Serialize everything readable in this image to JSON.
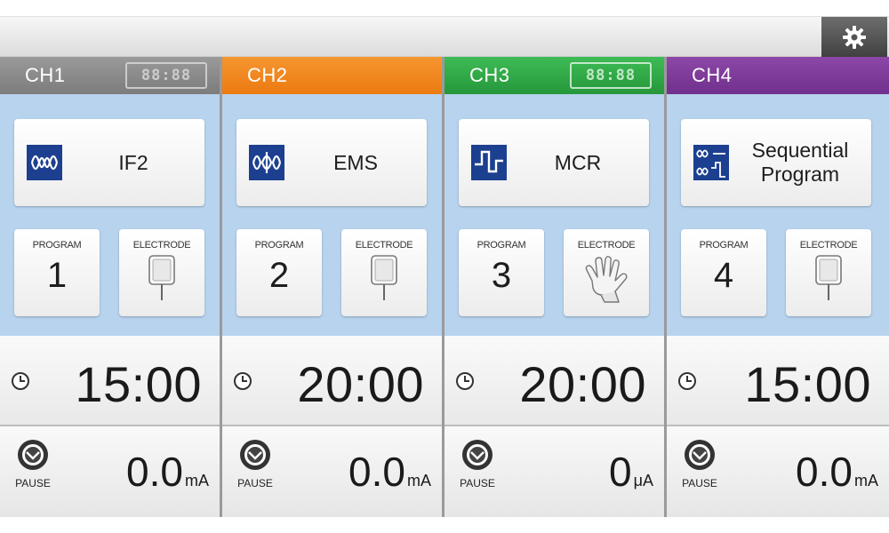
{
  "colors": {
    "ch1": "#8a8a8a",
    "ch2": "#f0861e",
    "ch3": "#2fa845",
    "ch4": "#7e3a9a",
    "body_bg": "#b7d3ee",
    "icon_blue": "#1c3f8f"
  },
  "topbar": {
    "settings_icon": "gear-icon"
  },
  "channels": [
    {
      "name": "CH1",
      "display": "88:88",
      "show_display": true,
      "mode": "IF2",
      "mode_icon": "if-wave-icon",
      "program_label": "PROGRAM",
      "program_number": "1",
      "electrode_label": "ELECTRODE",
      "electrode_icon": "pad-electrode-icon",
      "time": "15:00",
      "pause_label": "PAUSE",
      "output_value": "0.0",
      "output_unit": "mA"
    },
    {
      "name": "CH2",
      "display": "",
      "show_display": false,
      "mode": "EMS",
      "mode_icon": "ems-wave-icon",
      "program_label": "PROGRAM",
      "program_number": "2",
      "electrode_label": "ELECTRODE",
      "electrode_icon": "pad-electrode-icon",
      "time": "20:00",
      "pause_label": "PAUSE",
      "output_value": "0.0",
      "output_unit": "mA"
    },
    {
      "name": "CH3",
      "display": "88:88",
      "show_display": true,
      "mode": "MCR",
      "mode_icon": "mcr-wave-icon",
      "program_label": "PROGRAM",
      "program_number": "3",
      "electrode_label": "ELECTRODE",
      "electrode_icon": "glove-electrode-icon",
      "time": "20:00",
      "pause_label": "PAUSE",
      "output_value": "0",
      "output_unit": "μA"
    },
    {
      "name": "CH4",
      "display": "",
      "show_display": false,
      "mode": "Sequential Program",
      "mode_line1": "Sequential",
      "mode_line2": "Program",
      "mode_icon": "sequential-program-icon",
      "program_label": "PROGRAM",
      "program_number": "4",
      "electrode_label": "ELECTRODE",
      "electrode_icon": "pad-electrode-icon",
      "time": "15:00",
      "pause_label": "PAUSE",
      "output_value": "0.0",
      "output_unit": "mA"
    }
  ]
}
